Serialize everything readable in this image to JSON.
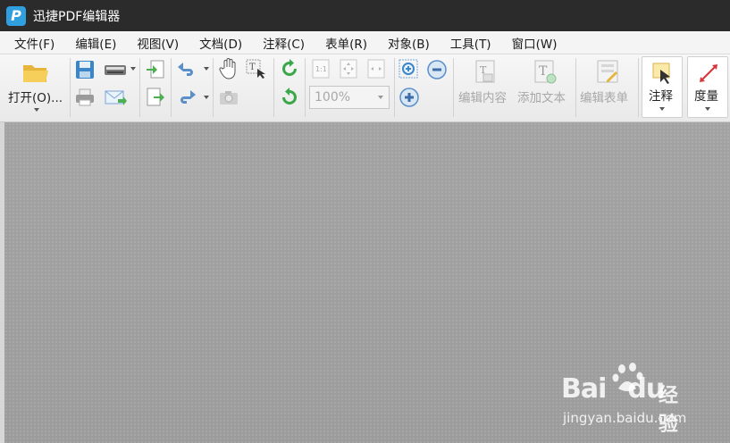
{
  "window": {
    "title": "迅捷PDF编辑器",
    "logo_letter": "P"
  },
  "menu": [
    {
      "id": "file",
      "label": "文件(F)"
    },
    {
      "id": "edit",
      "label": "编辑(E)"
    },
    {
      "id": "view",
      "label": "视图(V)"
    },
    {
      "id": "document",
      "label": "文档(D)"
    },
    {
      "id": "comment",
      "label": "注释(C)"
    },
    {
      "id": "form",
      "label": "表单(R)"
    },
    {
      "id": "object",
      "label": "对象(B)"
    },
    {
      "id": "tools",
      "label": "工具(T)"
    },
    {
      "id": "window",
      "label": "窗口(W)"
    }
  ],
  "toolbar": {
    "open_label": "打开(O)...",
    "zoom_value": "100%",
    "edit_content_label": "编辑内容",
    "add_text_label": "添加文本",
    "edit_form_label": "编辑表单",
    "annotate_label": "注释",
    "measure_label": "度量",
    "fit_actual_glyph": "1:1"
  },
  "watermark": {
    "logo": "Bai",
    "logo2": "du",
    "site_cn": "经验",
    "url": "jingyan.baidu.com"
  },
  "colors": {
    "accent": "#2f9fe0",
    "green": "#4caf50",
    "titlebar": "#2b2b2b",
    "canvas": "#a1a1a1"
  }
}
